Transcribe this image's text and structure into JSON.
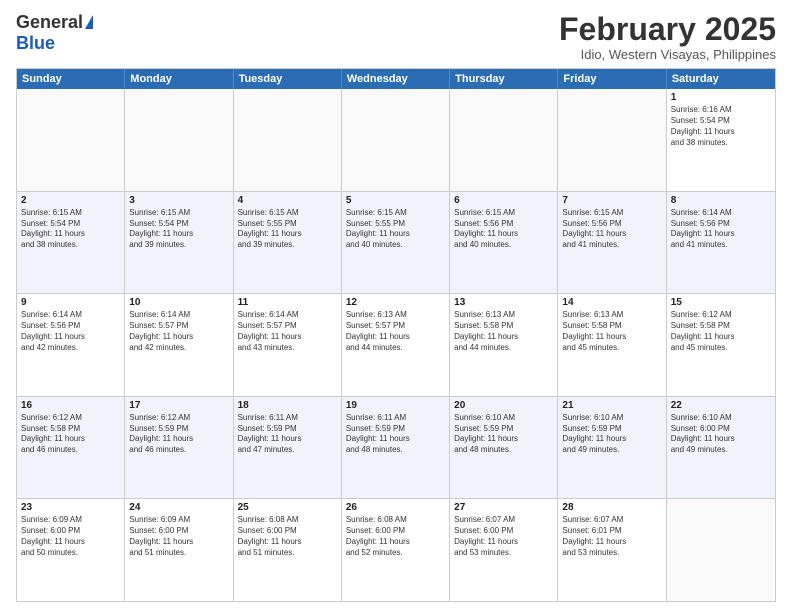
{
  "logo": {
    "general": "General",
    "blue": "Blue"
  },
  "title": "February 2025",
  "location": "Idio, Western Visayas, Philippines",
  "days_of_week": [
    "Sunday",
    "Monday",
    "Tuesday",
    "Wednesday",
    "Thursday",
    "Friday",
    "Saturday"
  ],
  "weeks": [
    [
      {
        "day": "",
        "info": "",
        "empty": true
      },
      {
        "day": "",
        "info": "",
        "empty": true
      },
      {
        "day": "",
        "info": "",
        "empty": true
      },
      {
        "day": "",
        "info": "",
        "empty": true
      },
      {
        "day": "",
        "info": "",
        "empty": true
      },
      {
        "day": "",
        "info": "",
        "empty": true
      },
      {
        "day": "1",
        "info": "Sunrise: 6:16 AM\nSunset: 5:54 PM\nDaylight: 11 hours\nand 38 minutes."
      }
    ],
    [
      {
        "day": "2",
        "info": "Sunrise: 6:15 AM\nSunset: 5:54 PM\nDaylight: 11 hours\nand 38 minutes."
      },
      {
        "day": "3",
        "info": "Sunrise: 6:15 AM\nSunset: 5:54 PM\nDaylight: 11 hours\nand 39 minutes."
      },
      {
        "day": "4",
        "info": "Sunrise: 6:15 AM\nSunset: 5:55 PM\nDaylight: 11 hours\nand 39 minutes."
      },
      {
        "day": "5",
        "info": "Sunrise: 6:15 AM\nSunset: 5:55 PM\nDaylight: 11 hours\nand 40 minutes."
      },
      {
        "day": "6",
        "info": "Sunrise: 6:15 AM\nSunset: 5:56 PM\nDaylight: 11 hours\nand 40 minutes."
      },
      {
        "day": "7",
        "info": "Sunrise: 6:15 AM\nSunset: 5:56 PM\nDaylight: 11 hours\nand 41 minutes."
      },
      {
        "day": "8",
        "info": "Sunrise: 6:14 AM\nSunset: 5:56 PM\nDaylight: 11 hours\nand 41 minutes."
      }
    ],
    [
      {
        "day": "9",
        "info": "Sunrise: 6:14 AM\nSunset: 5:56 PM\nDaylight: 11 hours\nand 42 minutes."
      },
      {
        "day": "10",
        "info": "Sunrise: 6:14 AM\nSunset: 5:57 PM\nDaylight: 11 hours\nand 42 minutes."
      },
      {
        "day": "11",
        "info": "Sunrise: 6:14 AM\nSunset: 5:57 PM\nDaylight: 11 hours\nand 43 minutes."
      },
      {
        "day": "12",
        "info": "Sunrise: 6:13 AM\nSunset: 5:57 PM\nDaylight: 11 hours\nand 44 minutes."
      },
      {
        "day": "13",
        "info": "Sunrise: 6:13 AM\nSunset: 5:58 PM\nDaylight: 11 hours\nand 44 minutes."
      },
      {
        "day": "14",
        "info": "Sunrise: 6:13 AM\nSunset: 5:58 PM\nDaylight: 11 hours\nand 45 minutes."
      },
      {
        "day": "15",
        "info": "Sunrise: 6:12 AM\nSunset: 5:58 PM\nDaylight: 11 hours\nand 45 minutes."
      }
    ],
    [
      {
        "day": "16",
        "info": "Sunrise: 6:12 AM\nSunset: 5:58 PM\nDaylight: 11 hours\nand 46 minutes."
      },
      {
        "day": "17",
        "info": "Sunrise: 6:12 AM\nSunset: 5:59 PM\nDaylight: 11 hours\nand 46 minutes."
      },
      {
        "day": "18",
        "info": "Sunrise: 6:11 AM\nSunset: 5:59 PM\nDaylight: 11 hours\nand 47 minutes."
      },
      {
        "day": "19",
        "info": "Sunrise: 6:11 AM\nSunset: 5:59 PM\nDaylight: 11 hours\nand 48 minutes."
      },
      {
        "day": "20",
        "info": "Sunrise: 6:10 AM\nSunset: 5:59 PM\nDaylight: 11 hours\nand 48 minutes."
      },
      {
        "day": "21",
        "info": "Sunrise: 6:10 AM\nSunset: 5:59 PM\nDaylight: 11 hours\nand 49 minutes."
      },
      {
        "day": "22",
        "info": "Sunrise: 6:10 AM\nSunset: 6:00 PM\nDaylight: 11 hours\nand 49 minutes."
      }
    ],
    [
      {
        "day": "23",
        "info": "Sunrise: 6:09 AM\nSunset: 6:00 PM\nDaylight: 11 hours\nand 50 minutes."
      },
      {
        "day": "24",
        "info": "Sunrise: 6:09 AM\nSunset: 6:00 PM\nDaylight: 11 hours\nand 51 minutes."
      },
      {
        "day": "25",
        "info": "Sunrise: 6:08 AM\nSunset: 6:00 PM\nDaylight: 11 hours\nand 51 minutes."
      },
      {
        "day": "26",
        "info": "Sunrise: 6:08 AM\nSunset: 6:00 PM\nDaylight: 11 hours\nand 52 minutes."
      },
      {
        "day": "27",
        "info": "Sunrise: 6:07 AM\nSunset: 6:00 PM\nDaylight: 11 hours\nand 53 minutes."
      },
      {
        "day": "28",
        "info": "Sunrise: 6:07 AM\nSunset: 6:01 PM\nDaylight: 11 hours\nand 53 minutes."
      },
      {
        "day": "",
        "info": "",
        "empty": true
      }
    ]
  ],
  "alt_rows": [
    1,
    3
  ]
}
